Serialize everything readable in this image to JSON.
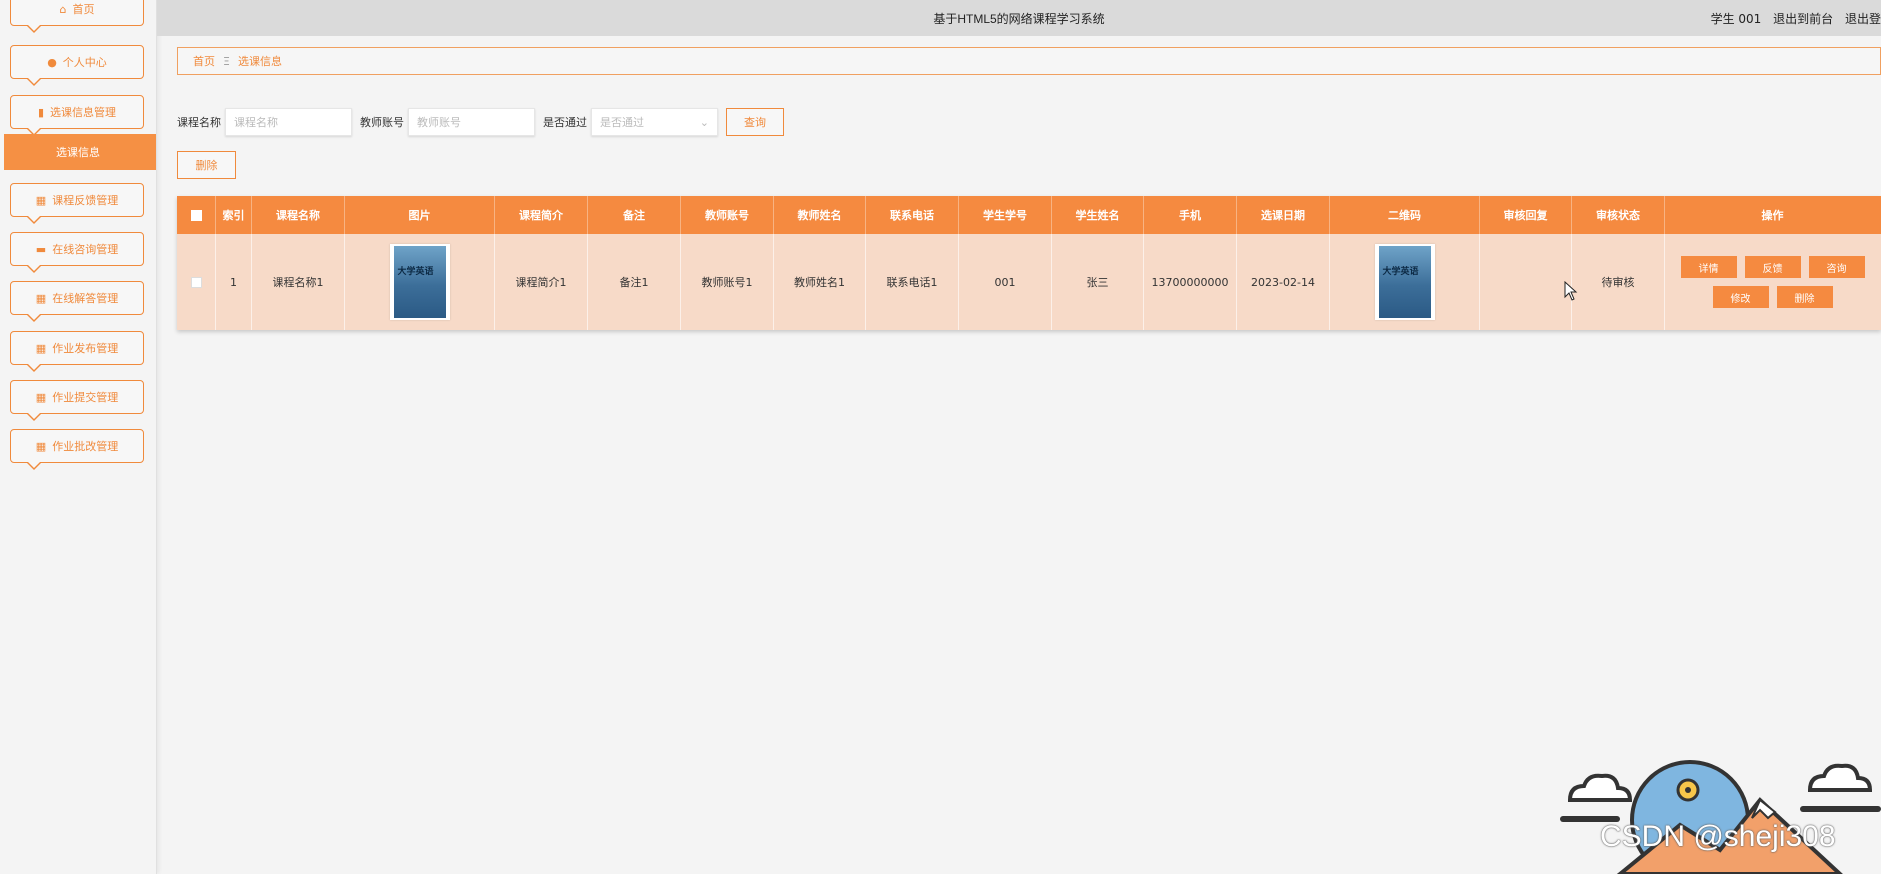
{
  "sidebar": {
    "items": [
      {
        "label": "首页",
        "icon": "home-icon"
      },
      {
        "label": "个人中心",
        "icon": "user-icon"
      },
      {
        "label": "选课信息管理",
        "icon": "clipboard-icon"
      },
      {
        "label": "课程反馈管理",
        "icon": "grid-icon"
      },
      {
        "label": "在线咨询管理",
        "icon": "monitor-icon"
      },
      {
        "label": "在线解答管理",
        "icon": "grid-icon"
      },
      {
        "label": "作业发布管理",
        "icon": "grid-icon"
      },
      {
        "label": "作业提交管理",
        "icon": "grid-icon"
      },
      {
        "label": "作业批改管理",
        "icon": "grid-icon"
      }
    ],
    "active_sub": "选课信息"
  },
  "header": {
    "title": "基于HTML5的网络课程学习系统",
    "user": "学生 001",
    "back_front": "退出到前台",
    "logout": "退出登"
  },
  "breadcrumb": {
    "home": "首页",
    "sep": "Ξ",
    "current": "选课信息"
  },
  "search": {
    "course_label": "课程名称",
    "course_placeholder": "课程名称",
    "teacher_label": "教师账号",
    "teacher_placeholder": "教师账号",
    "passed_label": "是否通过",
    "passed_placeholder": "是否通过",
    "query_button": "查询",
    "delete_button": "删除"
  },
  "table": {
    "headers": [
      "索引",
      "课程名称",
      "图片",
      "课程简介",
      "备注",
      "教师账号",
      "教师姓名",
      "联系电话",
      "学生学号",
      "学生姓名",
      "手机",
      "选课日期",
      "二维码",
      "审核回复",
      "审核状态",
      "操作"
    ],
    "rows": [
      {
        "index": "1",
        "course_name": "课程名称1",
        "image_text": "大学英语",
        "intro": "课程简介1",
        "remark": "备注1",
        "teacher_account": "教师账号1",
        "teacher_name": "教师姓名1",
        "phone": "联系电话1",
        "student_no": "001",
        "student_name": "张三",
        "mobile": "13700000000",
        "date": "2023-02-14",
        "qr_text": "大学英语",
        "reply": "",
        "status": "待审核",
        "ops": [
          "详情",
          "反馈",
          "咨询",
          "修改",
          "删除"
        ]
      }
    ]
  },
  "watermark": "CSDN @sheji308",
  "colors": {
    "accent": "#f58a40",
    "row_bg": "#f7dac8",
    "topbar": "#dadada"
  }
}
